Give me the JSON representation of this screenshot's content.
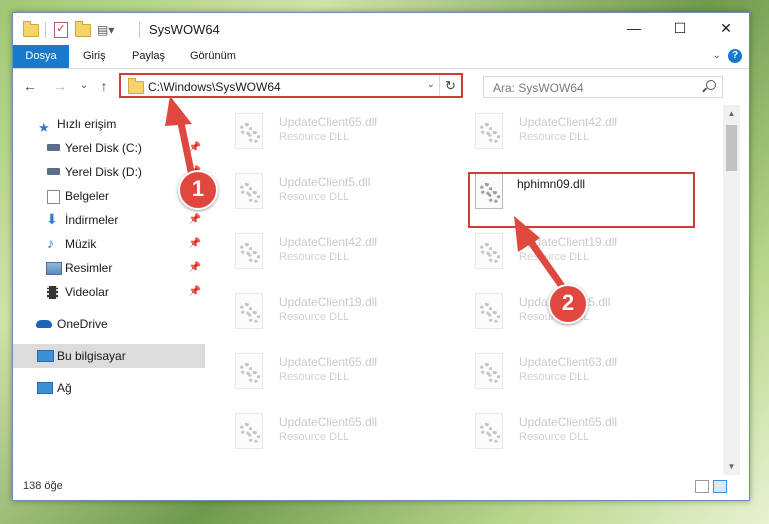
{
  "window": {
    "title": "SysWOW64",
    "minimize_glyph": "—",
    "maximize_glyph": "☐",
    "close_glyph": "✕"
  },
  "ribbon": {
    "tabs": [
      "Dosya",
      "Giriş",
      "Paylaş",
      "Görünüm"
    ],
    "help_glyph": "?",
    "expand_glyph": "⌄"
  },
  "nav": {
    "back_glyph": "←",
    "forward_glyph": "→",
    "recent_glyph": "⌄",
    "up_glyph": "↑",
    "address": "C:\\Windows\\SysWOW64",
    "address_dropdown_glyph": "⌄",
    "refresh_glyph": "↻",
    "search_placeholder": "Ara: SysWOW64"
  },
  "sidebar": {
    "items": [
      {
        "label": "Hızlı erişim",
        "icon": "star-icon",
        "pinned": false
      },
      {
        "label": "Yerel Disk (C:)",
        "icon": "drive-icon",
        "pinned": true
      },
      {
        "label": "Yerel Disk (D:)",
        "icon": "drive-icon",
        "pinned": true
      },
      {
        "label": "Belgeler",
        "icon": "documents-icon",
        "pinned": true
      },
      {
        "label": "İndirmeler",
        "icon": "download-icon",
        "pinned": true
      },
      {
        "label": "Müzik",
        "icon": "music-icon",
        "pinned": true
      },
      {
        "label": "Resimler",
        "icon": "pictures-icon",
        "pinned": true
      },
      {
        "label": "Videolar",
        "icon": "videos-icon",
        "pinned": true
      },
      {
        "label": "OneDrive",
        "icon": "cloud-icon",
        "pinned": false
      },
      {
        "label": "Bu bilgisayar",
        "icon": "computer-icon",
        "pinned": false
      },
      {
        "label": "Ağ",
        "icon": "network-icon",
        "pinned": false
      }
    ],
    "pin_glyph": "📌"
  },
  "files": {
    "left_column": [
      {
        "name": "UpdateClient65.dll",
        "type": "Resource DLL"
      },
      {
        "name": "UpdateClient5.dll",
        "type": "Resource DLL"
      },
      {
        "name": "UpdateClient42.dll",
        "type": "Resource DLL"
      },
      {
        "name": "UpdateClient19.dll",
        "type": "Resource DLL"
      },
      {
        "name": "UpdateClient65.dll",
        "type": "Resource DLL"
      },
      {
        "name": "UpdateClient65.dll",
        "type": "Resource DLL"
      }
    ],
    "right_column": [
      {
        "name": "UpdateClient42.dll",
        "type": "Resource DLL"
      },
      {
        "name": "hphimn09.dll",
        "type": ""
      },
      {
        "name": "UpdateClient19.dll",
        "type": "Resource DLL"
      },
      {
        "name": "UpdateClient5.dll",
        "type": "Resource DLL"
      },
      {
        "name": "UpdateClient63.dll",
        "type": "Resource DLL"
      },
      {
        "name": "UpdateClient65.dll",
        "type": "Resource DLL"
      }
    ]
  },
  "status": {
    "count": "138 öğe"
  },
  "annotations": {
    "badge1": "1",
    "badge2": "2",
    "color": "#e0483f"
  }
}
